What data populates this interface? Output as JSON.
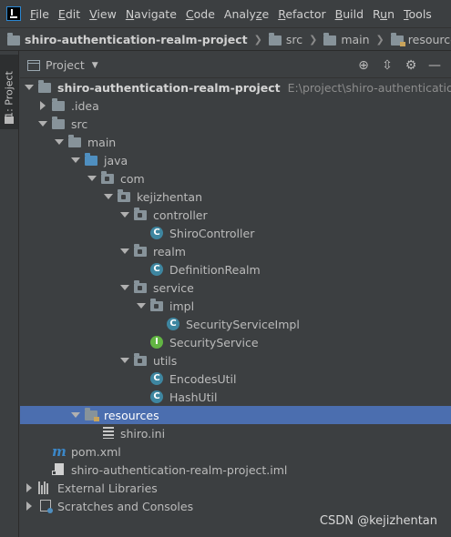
{
  "menu": {
    "items": [
      "File",
      "Edit",
      "View",
      "Navigate",
      "Code",
      "Analyze",
      "Refactor",
      "Build",
      "Run",
      "Tools"
    ],
    "mnemonics": [
      "F",
      "E",
      "V",
      "N",
      "C",
      "z",
      "R",
      "B",
      "u",
      "T"
    ]
  },
  "breadcrumb": {
    "items": [
      "shiro-authentication-realm-project",
      "src",
      "main",
      "resources"
    ]
  },
  "sidebar": {
    "tab_label": "1: Project"
  },
  "panel": {
    "title": "Project"
  },
  "tree": {
    "root": {
      "label": "shiro-authentication-realm-project",
      "path": "E:\\project\\shiro-authentication-realm"
    },
    "nodes": [
      {
        "label": ".idea"
      },
      {
        "label": "src"
      },
      {
        "label": "main"
      },
      {
        "label": "java"
      },
      {
        "label": "com"
      },
      {
        "label": "kejizhentan"
      },
      {
        "label": "controller"
      },
      {
        "label": "ShiroController",
        "badge": "C"
      },
      {
        "label": "realm"
      },
      {
        "label": "DefinitionRealm",
        "badge": "C"
      },
      {
        "label": "service"
      },
      {
        "label": "impl"
      },
      {
        "label": "SecurityServiceImpl",
        "badge": "C"
      },
      {
        "label": "SecurityService",
        "badge": "I"
      },
      {
        "label": "utils"
      },
      {
        "label": "EncodesUtil",
        "badge": "C"
      },
      {
        "label": "HashUtil",
        "badge": "C"
      },
      {
        "label": "resources"
      },
      {
        "label": "shiro.ini"
      },
      {
        "label": "pom.xml",
        "badge": "m"
      },
      {
        "label": "shiro-authentication-realm-project.iml"
      },
      {
        "label": "External Libraries"
      },
      {
        "label": "Scratches and Consoles"
      }
    ]
  },
  "watermark": "CSDN @kejizhentan",
  "colors": {
    "background": "#3c3f41",
    "selection": "#4b6eaf",
    "class_icon": "#3e86a0",
    "interface_icon": "#62b543",
    "maven": "#3b87c8"
  }
}
